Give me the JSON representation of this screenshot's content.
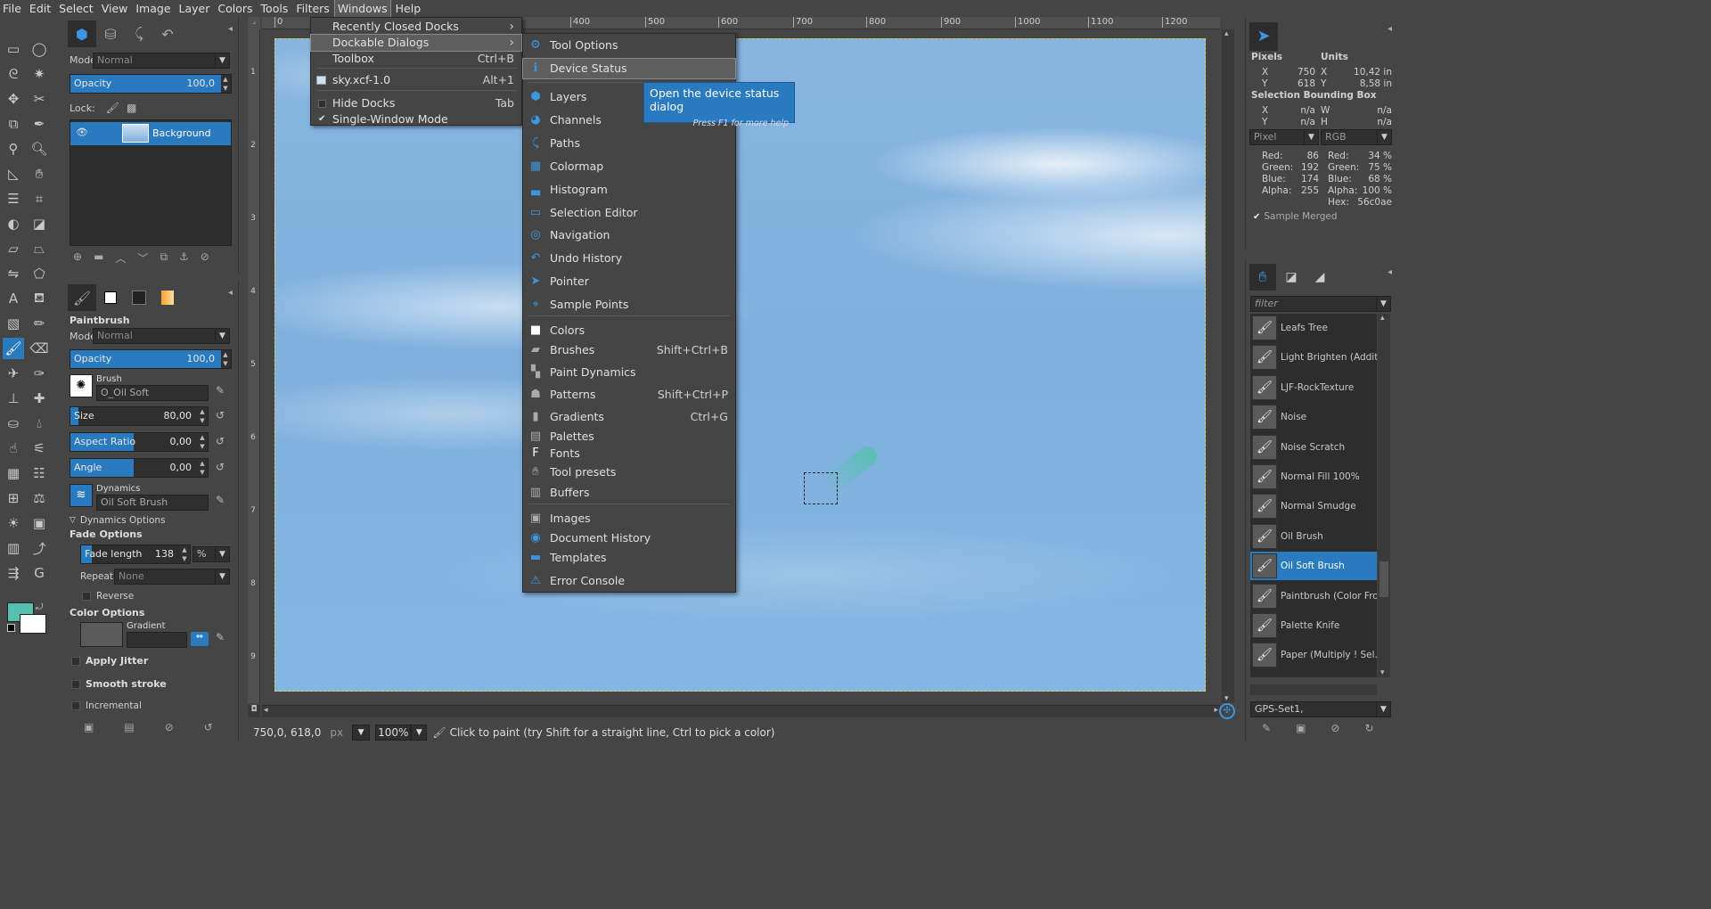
{
  "menubar": [
    "File",
    "Edit",
    "Select",
    "View",
    "Image",
    "Layer",
    "Colors",
    "Tools",
    "Filters",
    "Windows",
    "Help"
  ],
  "layers": {
    "mode_label": "Mode:",
    "mode_value": "Normal",
    "opacity_label": "Opacity",
    "opacity_value": "100,0",
    "opacity_fraction": 1.0,
    "lock_label": "Lock:",
    "layer_name": "Background"
  },
  "tool_options": {
    "title": "Paintbrush",
    "mode_label": "Mode:",
    "mode_value": "Normal",
    "opacity_label": "Opacity",
    "opacity_value": "100,0",
    "brush_label": "Brush",
    "brush_value": "O_Oil Soft",
    "size_label": "Size",
    "size_value": "80,00",
    "size_fraction": 0.04,
    "aspect_label": "Aspect Ratio",
    "aspect_value": "0,00",
    "angle_label": "Angle",
    "angle_value": "0,00",
    "dynamics_label": "Dynamics",
    "dynamics_value": "Oil Soft Brush",
    "dynamics_options": "Dynamics Options",
    "fade_options": "Fade Options",
    "fade_length_label": "Fade length",
    "fade_length_value": "138",
    "fade_unit": "%",
    "repeat_label": "Repeat:",
    "repeat_value": "None",
    "reverse_label": "Reverse",
    "color_options": "Color Options",
    "gradient_label": "Gradient",
    "apply_jitter": "Apply Jitter",
    "smooth_stroke": "Smooth stroke",
    "incremental": "Incremental"
  },
  "colors": {
    "foreground": "#56c0ae",
    "background": "#ffffff"
  },
  "ruler_h": [
    "0",
    "",
    "",
    "",
    "400",
    "500",
    "600",
    "700",
    "800",
    "900",
    "1000",
    "1100",
    "1200"
  ],
  "ruler_v": [
    "1",
    "2",
    "3",
    "4",
    "5",
    "6",
    "7",
    "8",
    "9"
  ],
  "windows_menu": {
    "items": [
      {
        "label": "Recently Closed Docks",
        "shortcut": "",
        "submenu": true
      },
      {
        "label": "Dockable Dialogs",
        "shortcut": "",
        "submenu": true
      },
      {
        "label": "Toolbox",
        "shortcut": "Ctrl+B"
      },
      {
        "label": "sky.xcf-1.0",
        "shortcut": "Alt+1"
      },
      {
        "label": "Hide Docks",
        "shortcut": "Tab"
      },
      {
        "label": "Single-Window Mode",
        "shortcut": "",
        "checked": true
      }
    ]
  },
  "dockable_menu": {
    "items": [
      {
        "label": "Tool Options",
        "shortcut": "",
        "icon": "tool-options-icon"
      },
      {
        "label": "Device Status",
        "shortcut": "",
        "icon": "device-status-icon"
      },
      {
        "label": "Layers",
        "shortcut": "",
        "icon": "layers-icon"
      },
      {
        "label": "Channels",
        "shortcut": "",
        "icon": "channels-icon"
      },
      {
        "label": "Paths",
        "shortcut": "",
        "icon": "paths-icon"
      },
      {
        "label": "Colormap",
        "shortcut": "",
        "icon": "colormap-icon"
      },
      {
        "label": "Histogram",
        "shortcut": "",
        "icon": "histogram-icon"
      },
      {
        "label": "Selection Editor",
        "shortcut": "",
        "icon": "selection-editor-icon"
      },
      {
        "label": "Navigation",
        "shortcut": "",
        "icon": "navigation-icon"
      },
      {
        "label": "Undo History",
        "shortcut": "",
        "icon": "undo-history-icon"
      },
      {
        "label": "Pointer",
        "shortcut": "",
        "icon": "pointer-icon"
      },
      {
        "label": "Sample Points",
        "shortcut": "",
        "icon": "sample-points-icon"
      },
      {
        "label": "Colors",
        "shortcut": "",
        "icon": "colors-icon"
      },
      {
        "label": "Brushes",
        "shortcut": "Shift+Ctrl+B",
        "icon": "brushes-icon"
      },
      {
        "label": "Paint Dynamics",
        "shortcut": "",
        "icon": "paint-dynamics-icon"
      },
      {
        "label": "Patterns",
        "shortcut": "Shift+Ctrl+P",
        "icon": "patterns-icon"
      },
      {
        "label": "Gradients",
        "shortcut": "Ctrl+G",
        "icon": "gradients-icon"
      },
      {
        "label": "Palettes",
        "shortcut": "",
        "icon": "palettes-icon"
      },
      {
        "label": "Fonts",
        "shortcut": "",
        "icon": "fonts-icon"
      },
      {
        "label": "Tool presets",
        "shortcut": "",
        "icon": "tool-presets-icon"
      },
      {
        "label": "Buffers",
        "shortcut": "",
        "icon": "buffers-icon"
      },
      {
        "label": "Images",
        "shortcut": "",
        "icon": "images-icon"
      },
      {
        "label": "Document History",
        "shortcut": "",
        "icon": "document-history-icon"
      },
      {
        "label": "Templates",
        "shortcut": "",
        "icon": "templates-icon"
      },
      {
        "label": "Error Console",
        "shortcut": "",
        "icon": "error-console-icon"
      }
    ]
  },
  "tooltip": {
    "main": "Open the device status dialog",
    "hint": "Press F1 for more help"
  },
  "pointer": {
    "pixels": "Pixels",
    "units": "Units",
    "x_label": "X",
    "y_label": "Y",
    "px_x": "750",
    "px_y": "618",
    "unit_x": "10,42 in",
    "unit_y": "8,58 in",
    "sel_title": "Selection Bounding Box",
    "w_label": "W",
    "h_label": "H",
    "na": "n/a",
    "left_mode": "Pixel",
    "right_mode": "RGB",
    "red": "Red:",
    "green": "Green:",
    "blue": "Blue:",
    "alpha": "Alpha:",
    "hex": "Hex:",
    "red_v": "86",
    "green_v": "192",
    "blue_v": "174",
    "alpha_v": "255",
    "red_p": "34 %",
    "green_p": "75 %",
    "blue_p": "68 %",
    "alpha_p": "100 %",
    "hex_v": "56c0ae",
    "sample_merged": "Sample Merged"
  },
  "brushes": {
    "filter_placeholder": "filter",
    "items": [
      "Leafs Tree",
      "Light Brighten (Addition",
      "LJF-RockTexture",
      "Noise",
      "Noise Scratch",
      "Normal Fill 100%",
      "Normal Smudge",
      "Oil Brush",
      "Oil Soft Brush",
      "Paintbrush (Color From G",
      "Palette Knife",
      "Paper (Multiply ! Sel.Patt"
    ],
    "selected": "Oil Soft Brush",
    "preset_set": "GPS-Set1,"
  },
  "status": {
    "coords": "750,0, 618,0",
    "unit": "px",
    "zoom": "100",
    "zoom_unit": "%",
    "message": "Click to paint (try Shift for a straight line, Ctrl to pick a color)"
  }
}
